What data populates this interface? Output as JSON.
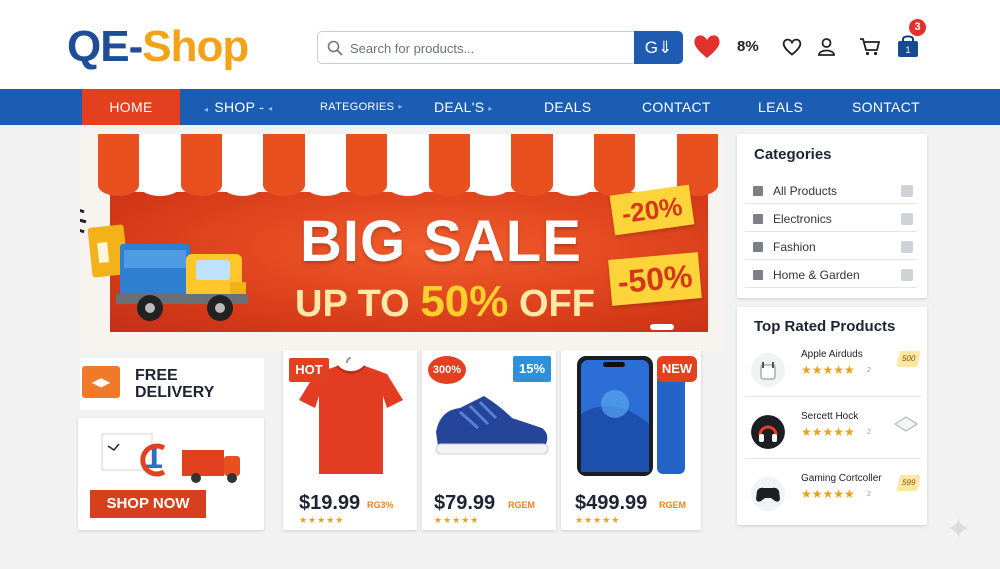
{
  "header": {
    "logo_part1": "QE-",
    "logo_part2": "Shop",
    "search_placeholder": "Search for products...",
    "search_button_label": "G⇓",
    "discount_text": "8%",
    "cart_count": "3"
  },
  "nav": {
    "items": [
      {
        "label": "HOME"
      },
      {
        "label": "SHOP -"
      },
      {
        "label": "RATEGORIES"
      },
      {
        "label": "DEAL'S"
      },
      {
        "label": "DEALS"
      },
      {
        "label": "CONTACT"
      },
      {
        "label": "LEALS"
      },
      {
        "label": "SONTACT"
      }
    ]
  },
  "hero": {
    "title": "BIG SALE",
    "subtitle_prefix": "UP TO ",
    "subtitle_highlight": "50%",
    "subtitle_suffix": " OFF",
    "tag_1": "-20%",
    "tag_2": "-50%"
  },
  "promo": {
    "free_line1": "FREE",
    "free_line2": "DELIVERY",
    "shop_now": "SHOP NOW"
  },
  "products": [
    {
      "badge": "HOT",
      "price": "$19.99",
      "price_sub": "RG3%",
      "stars": "★★★★★",
      "badge_color": "#e2401f"
    },
    {
      "badge": "300%",
      "price": "$79.99",
      "price_sub": "RGEM",
      "stars": "★★★★★",
      "badge_color": "#e2401f"
    },
    {
      "badge": "15%",
      "price": "$499.99",
      "price_sub": "RGEM",
      "stars": "★★★★★",
      "badge_color": "#2f8fd8"
    },
    {
      "badge": "NEW",
      "badge_color": "#e2401f"
    }
  ],
  "categories": {
    "title": "Categories",
    "items": [
      {
        "label": "All Products"
      },
      {
        "label": "Electronics"
      },
      {
        "label": "Fashion"
      },
      {
        "label": "Home & Garden"
      }
    ]
  },
  "top_rated": {
    "title": "Top Rated Products",
    "items": [
      {
        "name": "Apple Airduds",
        "stars": "★★★★★",
        "count": "2",
        "badge": "500"
      },
      {
        "name": "Sercett Hock",
        "stars": "★★★★★",
        "count": "2",
        "badge": ""
      },
      {
        "name": "Gaming Cortcoller",
        "stars": "★★★★★",
        "count": "2",
        "badge": "599"
      }
    ]
  },
  "colors": {
    "brand_blue": "#1c5db4",
    "brand_orange": "#f3a21a",
    "accent_red": "#e2401f",
    "star_gold": "#e9a21c"
  }
}
